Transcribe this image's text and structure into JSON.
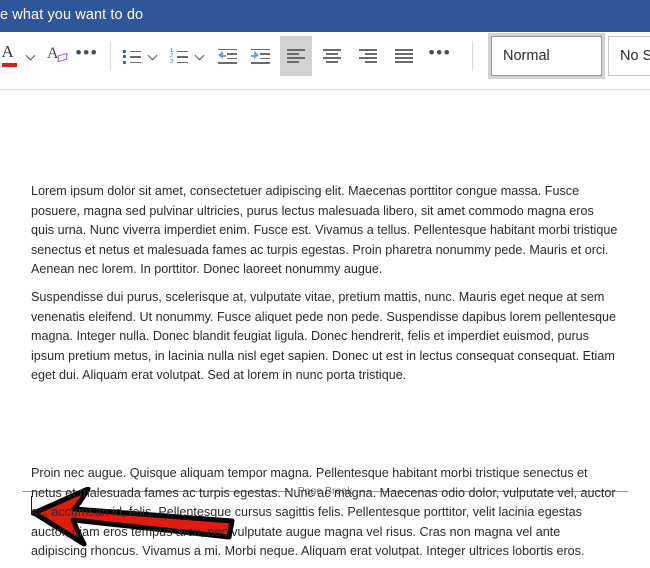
{
  "tellme": {
    "text": "e what you want to do",
    "bar_color": "#2f5699"
  },
  "ribbon": {
    "groups": [
      {
        "name": "font-group",
        "buttons": [
          {
            "name": "font-color-button",
            "icon": "font-color-icon",
            "label": "Font Color",
            "accent": "#d02020"
          },
          {
            "name": "font-color-dropdown",
            "icon": "chevron-down-icon",
            "label": "Font Color Options"
          },
          {
            "name": "clear-formatting-button",
            "icon": "clear-formatting-icon",
            "label": "Clear All Formatting"
          },
          {
            "name": "font-more-button",
            "icon": "ellipsis-icon",
            "label": "More Font Options"
          }
        ]
      },
      {
        "name": "paragraph-group",
        "buttons": [
          {
            "name": "bullet-list-button",
            "icon": "bullet-list-icon",
            "label": "Bullets"
          },
          {
            "name": "bullet-list-dropdown",
            "icon": "chevron-down-icon",
            "label": "Bullet Library"
          },
          {
            "name": "numbered-list-button",
            "icon": "numbered-list-icon",
            "label": "Numbering"
          },
          {
            "name": "numbered-list-dropdown",
            "icon": "chevron-down-icon",
            "label": "Numbering Library"
          },
          {
            "name": "decrease-indent-button",
            "icon": "decrease-indent-icon",
            "label": "Decrease Indent"
          },
          {
            "name": "increase-indent-button",
            "icon": "increase-indent-icon",
            "label": "Increase Indent"
          }
        ]
      },
      {
        "name": "alignment-group",
        "buttons": [
          {
            "name": "align-left-button",
            "icon": "align-left-icon",
            "label": "Align Left",
            "selected": true
          },
          {
            "name": "align-center-button",
            "icon": "align-center-icon",
            "label": "Center",
            "selected": false
          },
          {
            "name": "align-right-button",
            "icon": "align-right-icon",
            "label": "Align Right",
            "selected": false
          },
          {
            "name": "justify-button",
            "icon": "justify-icon",
            "label": "Justify",
            "selected": false
          },
          {
            "name": "paragraph-more-button",
            "icon": "ellipsis-icon",
            "label": "More Paragraph Options"
          }
        ]
      }
    ],
    "styles": [
      {
        "name": "style-normal",
        "label": "Normal",
        "active": true
      },
      {
        "name": "style-no-spacing",
        "label": "No Sp",
        "active": false
      }
    ]
  },
  "document": {
    "paragraphs": [
      {
        "id": "paragraph-1",
        "text": "Lorem ipsum dolor sit amet, consectetuer adipiscing elit. Maecenas porttitor congue massa. Fusce posuere, magna sed pulvinar ultricies, purus lectus malesuada libero, sit amet commodo magna eros quis urna. Nunc viverra imperdiet enim. Fusce est. Vivamus a tellus. Pellentesque habitant morbi tristique senectus et netus et malesuada fames ac turpis egestas. Proin pharetra nonummy pede. Mauris et orci. Aenean nec lorem. In porttitor. Donec laoreet nonummy augue."
      },
      {
        "id": "paragraph-2",
        "text": "Suspendisse dui purus, scelerisque at, vulputate vitae, pretium mattis, nunc. Mauris eget neque at sem venenatis eleifend. Ut nonummy. Fusce aliquet pede non pede. Suspendisse dapibus lorem pellentesque magna. Integer nulla. Donec blandit feugiat ligula. Donec hendrerit, felis et imperdiet euismod, purus ipsum pretium metus, in lacinia nulla nisl eget sapien. Donec ut est in lectus consequat consequat. Etiam eget dui. Aliquam erat volutpat. Sed at lorem in nunc porta tristique."
      },
      {
        "id": "paragraph-3",
        "text": "Proin nec augue. Quisque aliquam tempor magna. Pellentesque habitant morbi tristique senectus et netus et malesuada fames ac turpis egestas. Nunc ac magna. Maecenas odio dolor, vulputate vel, auctor ac, accumsan id, felis. Pellentesque cursus sagittis felis. Pellentesque porttitor, velit lacinia egestas auctor, diam eros tempus arcu, nec vulputate augue magna vel risus. Cras non magna vel ante adipiscing rhoncus. Vivamus a mi. Morbi neque. Aliquam erat volutpat. Integer ultrices lobortis eros."
      }
    ],
    "page_break_label": "Page Break"
  },
  "annotation": {
    "name": "red-arrow",
    "direction": "left",
    "fill_color": "#e01b10",
    "stroke_color": "#000000"
  }
}
